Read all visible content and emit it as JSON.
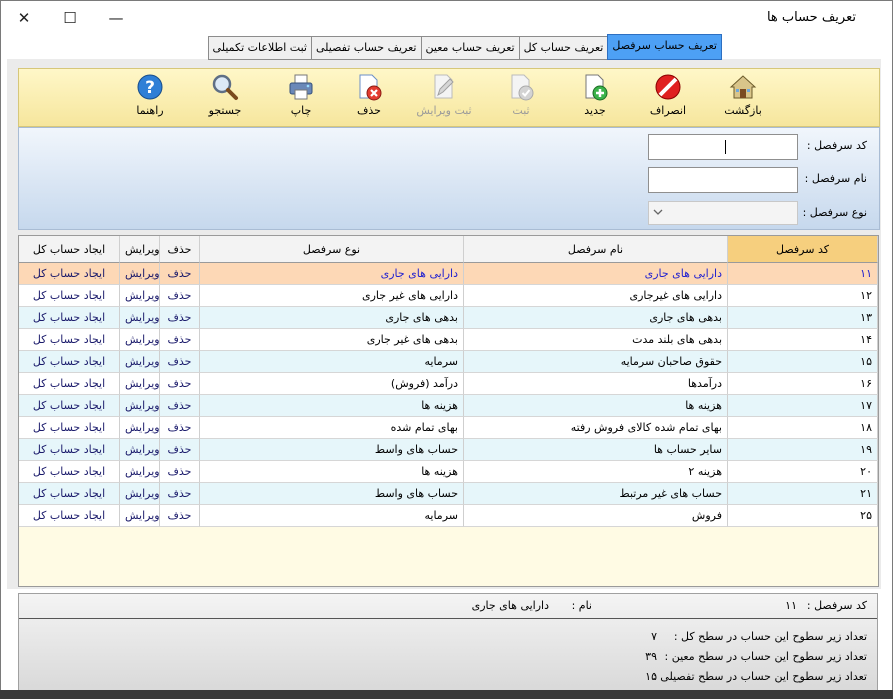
{
  "window": {
    "title": "تعریف حساب ها",
    "minimize": "—",
    "maximize": "☐",
    "close": "✕"
  },
  "tabs": [
    {
      "label": "تعریف حساب سرفصل",
      "active": true
    },
    {
      "label": "تعریف حساب کل",
      "active": false
    },
    {
      "label": "تعریف حساب معین",
      "active": false
    },
    {
      "label": "تعریف حساب تفصیلی",
      "active": false
    },
    {
      "label": "ثبت اطلاعات تکمیلی",
      "active": false
    }
  ],
  "toolbar": {
    "back": "بازگشت",
    "cancel": "انصراف",
    "new": "جدید",
    "save": "ثبت",
    "save_edit": "ثبت ویرایش",
    "delete": "حذف",
    "print": "چاپ",
    "search": "جستجو",
    "help": "راهنما"
  },
  "form": {
    "code_label": "کد سرفصل :",
    "name_label": "نام سرفصل :",
    "type_label": "نوع سرفصل :"
  },
  "grid": {
    "headers": {
      "code": "کد سرفصل",
      "name": "نام سرفصل",
      "type": "نوع سرفصل",
      "delete": "حذف",
      "edit": "ویرایش",
      "create": "ایجاد حساب کل"
    },
    "rows": [
      {
        "code": "۱۱",
        "name": "دارایی های جاری",
        "type": "دارایی های جاری",
        "delete": "حذف",
        "edit": "ویرایش",
        "create": "ایجاد حساب کل"
      },
      {
        "code": "۱۲",
        "name": "دارایی های غیرجاری",
        "type": "دارایی های غیر جاری",
        "delete": "حذف",
        "edit": "ویرایش",
        "create": "ایجاد حساب کل"
      },
      {
        "code": "۱۳",
        "name": "بدهی های جاری",
        "type": "بدهی های جاری",
        "delete": "حذف",
        "edit": "ویرایش",
        "create": "ایجاد حساب کل"
      },
      {
        "code": "۱۴",
        "name": "بدهی های بلند مدت",
        "type": "بدهی های غیر جاری",
        "delete": "حذف",
        "edit": "ویرایش",
        "create": "ایجاد حساب کل"
      },
      {
        "code": "۱۵",
        "name": "حقوق صاحبان سرمایه",
        "type": "سرمایه",
        "delete": "حذف",
        "edit": "ویرایش",
        "create": "ایجاد حساب کل"
      },
      {
        "code": "۱۶",
        "name": "درآمدها",
        "type": "درآمد (فروش)",
        "delete": "حذف",
        "edit": "ویرایش",
        "create": "ایجاد حساب کل"
      },
      {
        "code": "۱۷",
        "name": "هزینه ها",
        "type": "هزینه ها",
        "delete": "حذف",
        "edit": "ویرایش",
        "create": "ایجاد حساب کل"
      },
      {
        "code": "۱۸",
        "name": "بهای تمام شده کالای فروش رفته",
        "type": "بهای تمام شده",
        "delete": "حذف",
        "edit": "ویرایش",
        "create": "ایجاد حساب کل"
      },
      {
        "code": "۱۹",
        "name": "سایر حساب ها",
        "type": "حساب های واسط",
        "delete": "حذف",
        "edit": "ویرایش",
        "create": "ایجاد حساب کل"
      },
      {
        "code": "۲۰",
        "name": "هزینه ۲",
        "type": "هزینه ها",
        "delete": "حذف",
        "edit": "ویرایش",
        "create": "ایجاد حساب کل"
      },
      {
        "code": "۲۱",
        "name": "حساب های غیر مرتبط",
        "type": "حساب های واسط",
        "delete": "حذف",
        "edit": "ویرایش",
        "create": "ایجاد حساب کل"
      },
      {
        "code": "۲۵",
        "name": "فروش",
        "type": "سرمایه",
        "delete": "حذف",
        "edit": "ویرایش",
        "create": "ایجاد حساب کل"
      }
    ]
  },
  "info": {
    "code_label": "کد سرفصل :",
    "code_value": "۱۱",
    "name_label": "نام :",
    "name_value": "دارایی های جاری",
    "count_kol_label": "تعداد زیر سطوح این حساب در سطح کل :",
    "count_kol_value": "۷",
    "count_moein_label": "تعداد زیر سطوح این حساب در سطح معین :",
    "count_moein_value": "۳۹",
    "count_tafsili_label": "تعداد زیر سطوح این حساب در سطح تفصیلی :",
    "count_tafsili_value": "۱۵"
  }
}
